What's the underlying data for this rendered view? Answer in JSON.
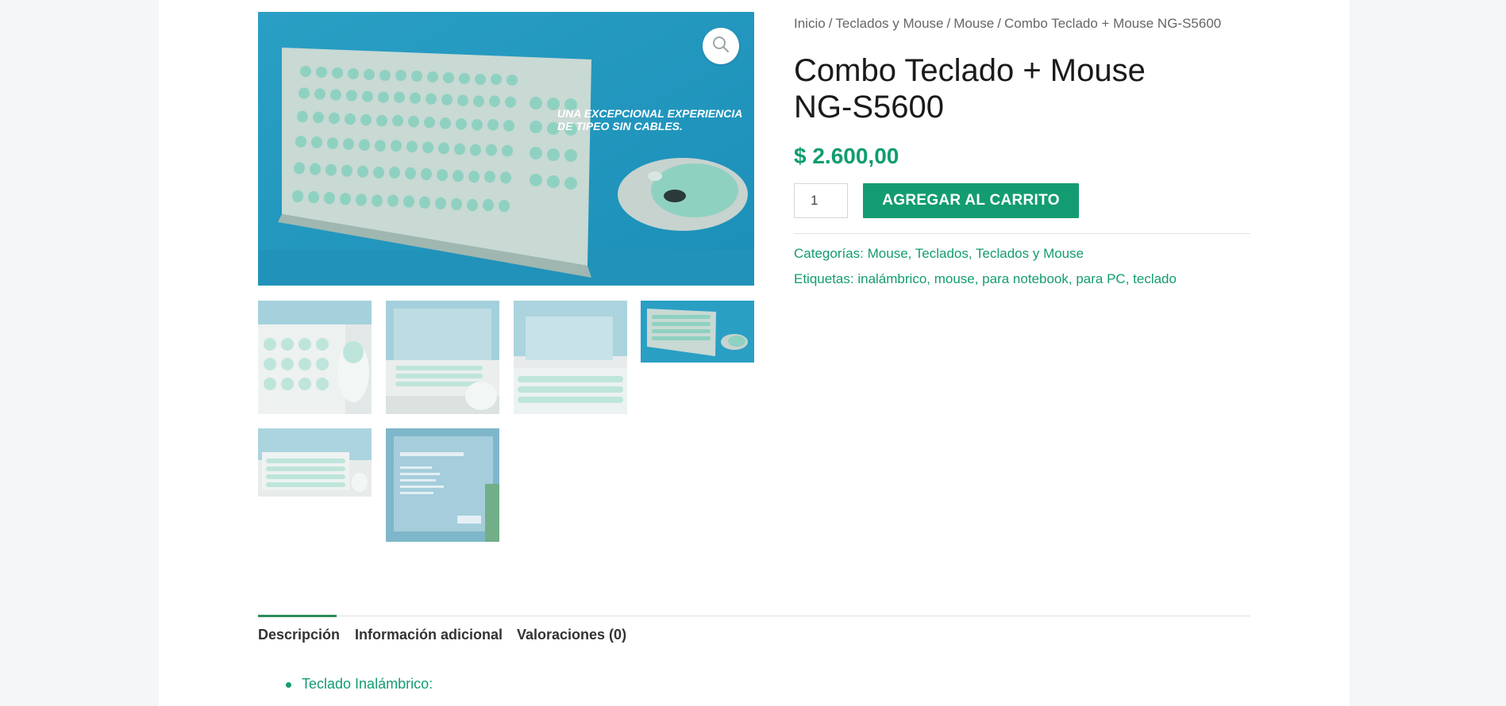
{
  "breadcrumb": {
    "home": "Inicio",
    "cat": "Teclados y Mouse",
    "sub": "Mouse",
    "current": "Combo Teclado + Mouse NG-S5600",
    "separator": "/"
  },
  "product": {
    "title": "Combo Teclado + Mouse NG-S5600",
    "price": "$ 2.600,00",
    "quantity": "1",
    "add_to_cart": "AGREGAR AL CARRITO",
    "image_slogan_line1": "UNA EXCEPCIONAL EXPERIENCIA",
    "image_slogan_line2": "DE TIPEO SIN CABLES."
  },
  "meta": {
    "categories_label": "Categorías:",
    "categories": "Mouse, Teclados, Teclados y Mouse",
    "tags_label": "Etiquetas:",
    "tags": "inalámbrico, mouse, para notebook, para PC, teclado"
  },
  "tabs": [
    {
      "label": "Descripción"
    },
    {
      "label": "Información adicional"
    },
    {
      "label": "Valoraciones (0)"
    }
  ],
  "description": {
    "items": [
      "Teclado Inalámbrico:"
    ]
  },
  "icons": {
    "zoom": "magnifier-icon"
  },
  "colors": {
    "accent": "#139c72",
    "background": "#f5f6f8"
  }
}
